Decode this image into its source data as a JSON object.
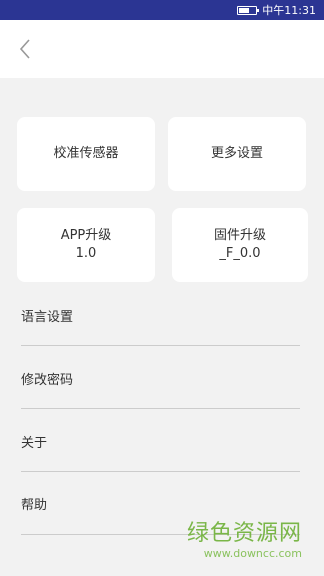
{
  "status_bar": {
    "time": "中午11:31",
    "battery_level": 0.6
  },
  "header": {
    "back_icon": "chevron-left-icon"
  },
  "cards": {
    "calibrate_label": "校准传感器",
    "more_settings_label": "更多设置",
    "app_upgrade_label": "APP升级",
    "app_version": "1.0",
    "firmware_upgrade_label": "固件升级",
    "firmware_version": "_F_0.0"
  },
  "list": {
    "items": [
      {
        "label": "语言设置"
      },
      {
        "label": "修改密码"
      },
      {
        "label": "关于"
      },
      {
        "label": "帮助"
      }
    ]
  },
  "watermark": {
    "title": "绿色资源网",
    "url": "www.downcc.com"
  },
  "colors": {
    "status_bar": "#2b3593",
    "background": "#f2f2f2",
    "card": "#ffffff",
    "watermark": "#7ab648"
  }
}
